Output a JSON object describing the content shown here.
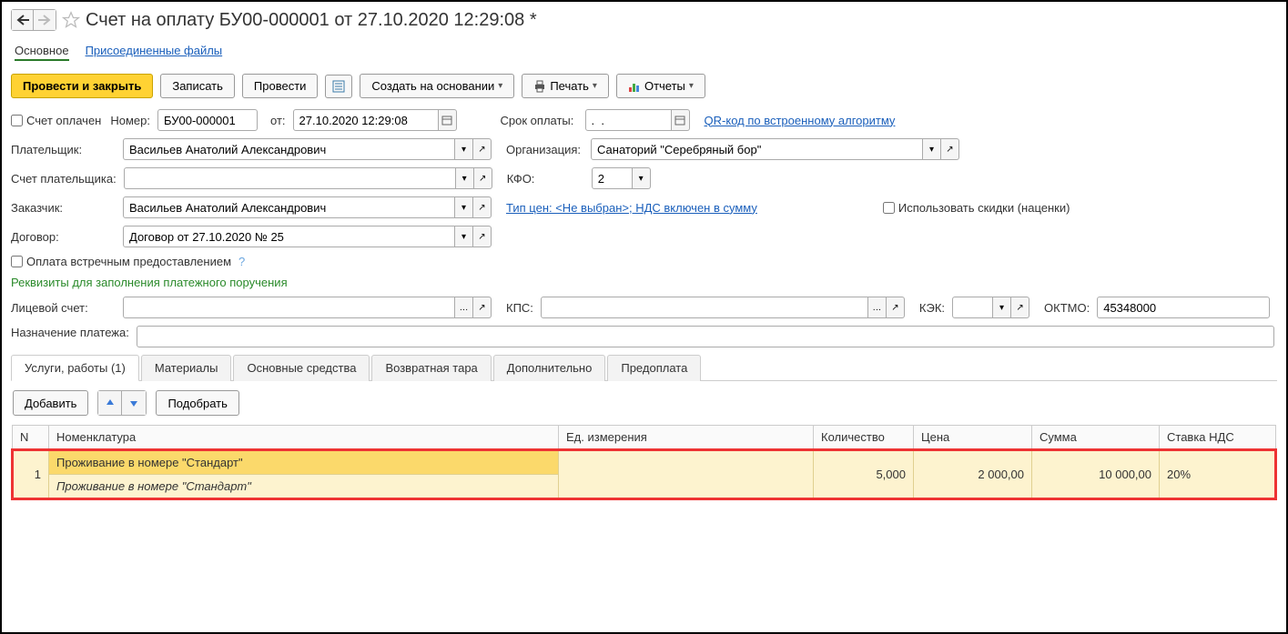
{
  "title": "Счет на оплату БУ00-000001 от 27.10.2020 12:29:08 *",
  "nav_tabs": {
    "main": "Основное",
    "attached": "Присоединенные файлы"
  },
  "toolbar": {
    "post_close": "Провести и закрыть",
    "save": "Записать",
    "post": "Провести",
    "create_from": "Создать на основании",
    "print": "Печать",
    "reports": "Отчеты"
  },
  "fields": {
    "paid_label": "Счет оплачен",
    "number_label": "Номер:",
    "number_value": "БУ00-000001",
    "from_label": "от:",
    "date_value": "27.10.2020 12:29:08",
    "due_label": "Срок оплаты:",
    "due_value": ".  .",
    "qr_link": "QR-код по встроенному алгоритму",
    "payer_label": "Плательщик:",
    "payer_value": "Васильев Анатолий Александрович",
    "org_label": "Организация:",
    "org_value": "Санаторий \"Серебряный бор\"",
    "payer_acc_label": "Счет плательщика:",
    "kfo_label": "КФО:",
    "kfo_value": "2",
    "customer_label": "Заказчик:",
    "customer_value": "Васильев Анатолий Александрович",
    "price_type_link": "Тип цен: <Не выбран>; НДС включен в сумму",
    "discount_label": "Использовать скидки (наценки)",
    "contract_label": "Договор:",
    "contract_value": "Договор от 27.10.2020 № 25",
    "counter_payment_label": "Оплата встречным предоставлением",
    "section_requisites": "Реквизиты для заполнения платежного поручения",
    "account_label": "Лицевой счет:",
    "kps_label": "КПС:",
    "kek_label": "КЭК:",
    "oktmo_label": "ОКТМО:",
    "oktmo_value": "45348000",
    "purpose_label": "Назначение платежа:"
  },
  "table_tabs": {
    "services": "Услуги, работы (1)",
    "materials": "Материалы",
    "assets": "Основные средства",
    "returnable": "Возвратная тара",
    "additional": "Дополнительно",
    "prepayment": "Предоплата"
  },
  "table_toolbar": {
    "add": "Добавить",
    "pick": "Подобрать"
  },
  "table": {
    "cols": {
      "n": "N",
      "nomen": "Номенклатура",
      "unit": "Ед. измерения",
      "qty": "Количество",
      "price": "Цена",
      "sum": "Сумма",
      "vat": "Ставка НДС"
    },
    "rows": [
      {
        "n": "1",
        "nomen": "Проживание в номере \"Стандарт\"",
        "desc": "Проживание в номере \"Стандарт\"",
        "unit": "",
        "qty": "5,000",
        "price": "2 000,00",
        "sum": "10 000,00",
        "vat": "20%"
      }
    ]
  }
}
